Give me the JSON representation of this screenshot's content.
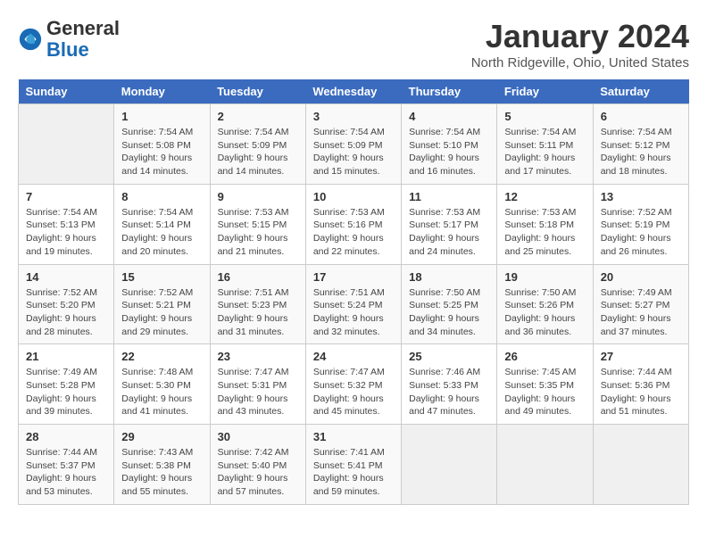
{
  "header": {
    "logo_general": "General",
    "logo_blue": "Blue",
    "month_year": "January 2024",
    "location": "North Ridgeville, Ohio, United States"
  },
  "days_of_week": [
    "Sunday",
    "Monday",
    "Tuesday",
    "Wednesday",
    "Thursday",
    "Friday",
    "Saturday"
  ],
  "weeks": [
    [
      {
        "day": "",
        "sunrise": "",
        "sunset": "",
        "daylight": ""
      },
      {
        "day": "1",
        "sunrise": "Sunrise: 7:54 AM",
        "sunset": "Sunset: 5:08 PM",
        "daylight": "Daylight: 9 hours and 14 minutes."
      },
      {
        "day": "2",
        "sunrise": "Sunrise: 7:54 AM",
        "sunset": "Sunset: 5:09 PM",
        "daylight": "Daylight: 9 hours and 14 minutes."
      },
      {
        "day": "3",
        "sunrise": "Sunrise: 7:54 AM",
        "sunset": "Sunset: 5:09 PM",
        "daylight": "Daylight: 9 hours and 15 minutes."
      },
      {
        "day": "4",
        "sunrise": "Sunrise: 7:54 AM",
        "sunset": "Sunset: 5:10 PM",
        "daylight": "Daylight: 9 hours and 16 minutes."
      },
      {
        "day": "5",
        "sunrise": "Sunrise: 7:54 AM",
        "sunset": "Sunset: 5:11 PM",
        "daylight": "Daylight: 9 hours and 17 minutes."
      },
      {
        "day": "6",
        "sunrise": "Sunrise: 7:54 AM",
        "sunset": "Sunset: 5:12 PM",
        "daylight": "Daylight: 9 hours and 18 minutes."
      }
    ],
    [
      {
        "day": "7",
        "sunrise": "Sunrise: 7:54 AM",
        "sunset": "Sunset: 5:13 PM",
        "daylight": "Daylight: 9 hours and 19 minutes."
      },
      {
        "day": "8",
        "sunrise": "Sunrise: 7:54 AM",
        "sunset": "Sunset: 5:14 PM",
        "daylight": "Daylight: 9 hours and 20 minutes."
      },
      {
        "day": "9",
        "sunrise": "Sunrise: 7:53 AM",
        "sunset": "Sunset: 5:15 PM",
        "daylight": "Daylight: 9 hours and 21 minutes."
      },
      {
        "day": "10",
        "sunrise": "Sunrise: 7:53 AM",
        "sunset": "Sunset: 5:16 PM",
        "daylight": "Daylight: 9 hours and 22 minutes."
      },
      {
        "day": "11",
        "sunrise": "Sunrise: 7:53 AM",
        "sunset": "Sunset: 5:17 PM",
        "daylight": "Daylight: 9 hours and 24 minutes."
      },
      {
        "day": "12",
        "sunrise": "Sunrise: 7:53 AM",
        "sunset": "Sunset: 5:18 PM",
        "daylight": "Daylight: 9 hours and 25 minutes."
      },
      {
        "day": "13",
        "sunrise": "Sunrise: 7:52 AM",
        "sunset": "Sunset: 5:19 PM",
        "daylight": "Daylight: 9 hours and 26 minutes."
      }
    ],
    [
      {
        "day": "14",
        "sunrise": "Sunrise: 7:52 AM",
        "sunset": "Sunset: 5:20 PM",
        "daylight": "Daylight: 9 hours and 28 minutes."
      },
      {
        "day": "15",
        "sunrise": "Sunrise: 7:52 AM",
        "sunset": "Sunset: 5:21 PM",
        "daylight": "Daylight: 9 hours and 29 minutes."
      },
      {
        "day": "16",
        "sunrise": "Sunrise: 7:51 AM",
        "sunset": "Sunset: 5:23 PM",
        "daylight": "Daylight: 9 hours and 31 minutes."
      },
      {
        "day": "17",
        "sunrise": "Sunrise: 7:51 AM",
        "sunset": "Sunset: 5:24 PM",
        "daylight": "Daylight: 9 hours and 32 minutes."
      },
      {
        "day": "18",
        "sunrise": "Sunrise: 7:50 AM",
        "sunset": "Sunset: 5:25 PM",
        "daylight": "Daylight: 9 hours and 34 minutes."
      },
      {
        "day": "19",
        "sunrise": "Sunrise: 7:50 AM",
        "sunset": "Sunset: 5:26 PM",
        "daylight": "Daylight: 9 hours and 36 minutes."
      },
      {
        "day": "20",
        "sunrise": "Sunrise: 7:49 AM",
        "sunset": "Sunset: 5:27 PM",
        "daylight": "Daylight: 9 hours and 37 minutes."
      }
    ],
    [
      {
        "day": "21",
        "sunrise": "Sunrise: 7:49 AM",
        "sunset": "Sunset: 5:28 PM",
        "daylight": "Daylight: 9 hours and 39 minutes."
      },
      {
        "day": "22",
        "sunrise": "Sunrise: 7:48 AM",
        "sunset": "Sunset: 5:30 PM",
        "daylight": "Daylight: 9 hours and 41 minutes."
      },
      {
        "day": "23",
        "sunrise": "Sunrise: 7:47 AM",
        "sunset": "Sunset: 5:31 PM",
        "daylight": "Daylight: 9 hours and 43 minutes."
      },
      {
        "day": "24",
        "sunrise": "Sunrise: 7:47 AM",
        "sunset": "Sunset: 5:32 PM",
        "daylight": "Daylight: 9 hours and 45 minutes."
      },
      {
        "day": "25",
        "sunrise": "Sunrise: 7:46 AM",
        "sunset": "Sunset: 5:33 PM",
        "daylight": "Daylight: 9 hours and 47 minutes."
      },
      {
        "day": "26",
        "sunrise": "Sunrise: 7:45 AM",
        "sunset": "Sunset: 5:35 PM",
        "daylight": "Daylight: 9 hours and 49 minutes."
      },
      {
        "day": "27",
        "sunrise": "Sunrise: 7:44 AM",
        "sunset": "Sunset: 5:36 PM",
        "daylight": "Daylight: 9 hours and 51 minutes."
      }
    ],
    [
      {
        "day": "28",
        "sunrise": "Sunrise: 7:44 AM",
        "sunset": "Sunset: 5:37 PM",
        "daylight": "Daylight: 9 hours and 53 minutes."
      },
      {
        "day": "29",
        "sunrise": "Sunrise: 7:43 AM",
        "sunset": "Sunset: 5:38 PM",
        "daylight": "Daylight: 9 hours and 55 minutes."
      },
      {
        "day": "30",
        "sunrise": "Sunrise: 7:42 AM",
        "sunset": "Sunset: 5:40 PM",
        "daylight": "Daylight: 9 hours and 57 minutes."
      },
      {
        "day": "31",
        "sunrise": "Sunrise: 7:41 AM",
        "sunset": "Sunset: 5:41 PM",
        "daylight": "Daylight: 9 hours and 59 minutes."
      },
      {
        "day": "",
        "sunrise": "",
        "sunset": "",
        "daylight": ""
      },
      {
        "day": "",
        "sunrise": "",
        "sunset": "",
        "daylight": ""
      },
      {
        "day": "",
        "sunrise": "",
        "sunset": "",
        "daylight": ""
      }
    ]
  ]
}
